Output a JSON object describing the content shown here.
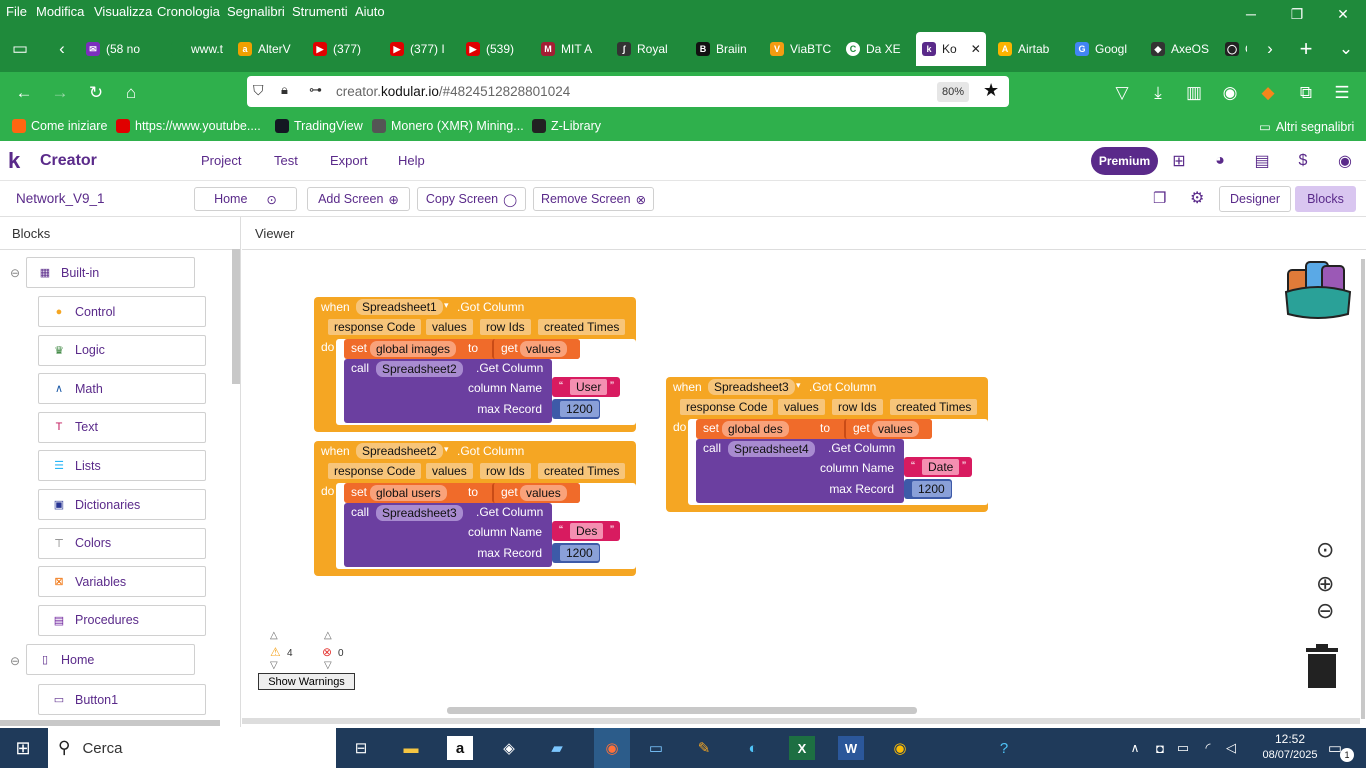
{
  "menubar": {
    "items": [
      "File",
      "Modifica",
      "Visualizza",
      "Cronologia",
      "Segnalibri",
      "Strumenti",
      "Aiuto"
    ]
  },
  "tabs": [
    {
      "label": "(58 no",
      "color": "#7b2fbe",
      "glyph": "✉"
    },
    {
      "label": "www.t",
      "color": "#1f8a3b",
      "glyph": ""
    },
    {
      "label": "AlterV",
      "color": "#f0a000",
      "glyph": "a"
    },
    {
      "label": "(377)",
      "color": "#e00000",
      "glyph": "▶"
    },
    {
      "label": "(377) I",
      "color": "#e00000",
      "glyph": "▶"
    },
    {
      "label": "(539)",
      "color": "#e00000",
      "glyph": "▶"
    },
    {
      "label": "MIT A",
      "color": "#a31f34",
      "glyph": "M"
    },
    {
      "label": "Royal",
      "color": "#333333",
      "glyph": "∫"
    },
    {
      "label": "Braiin",
      "color": "#111111",
      "glyph": "B"
    },
    {
      "label": "ViaBTC",
      "color": "#f39c12",
      "glyph": "V"
    },
    {
      "label": "Da XE",
      "color": "#ffffff",
      "glyph": "C"
    },
    {
      "label": "Ko",
      "color": "#5a2a8a",
      "glyph": "k"
    },
    {
      "label": "Airtab",
      "color": "#fcb400",
      "glyph": "A"
    },
    {
      "label": "Googl",
      "color": "#4285f4",
      "glyph": "G"
    },
    {
      "label": "AxeOS",
      "color": "#333333",
      "glyph": "◆"
    },
    {
      "label": "G",
      "color": "#222222",
      "glyph": "◯"
    }
  ],
  "url": {
    "prefix": "creator.",
    "domain": "kodular.io",
    "path": "/#4824512828801024",
    "zoom": "80%"
  },
  "bookmarks": [
    {
      "label": "Come iniziare",
      "color": "#ff6611"
    },
    {
      "label": "https://www.youtube....",
      "color": "#e00000"
    },
    {
      "label": "TradingView",
      "color": "#131722"
    },
    {
      "label": "Monero (XMR) Mining...",
      "color": "#555555"
    },
    {
      "label": "Z-Library",
      "color": "#222222"
    }
  ],
  "bookmarks_other": "Altri segnalibri",
  "app": {
    "logo": "Creator",
    "menus": [
      "Project",
      "Test",
      "Export",
      "Help"
    ],
    "premium": "Premium"
  },
  "screenbar": {
    "project": "Network_V9_1",
    "home": "Home",
    "add": "Add Screen",
    "copy": "Copy Screen",
    "remove": "Remove Screen",
    "designer": "Designer",
    "blocks": "Blocks"
  },
  "panel": {
    "title": "Blocks",
    "viewer": "Viewer"
  },
  "categories": [
    {
      "label": "Built-in",
      "color": "#5a2a8a",
      "glyph": "▦"
    },
    {
      "label": "Control",
      "color": "#f5a623",
      "glyph": "●"
    },
    {
      "label": "Logic",
      "color": "#2e7d32",
      "glyph": "♛"
    },
    {
      "label": "Math",
      "color": "#1e5ba8",
      "glyph": "∧"
    },
    {
      "label": "Text",
      "color": "#c2185b",
      "glyph": "T"
    },
    {
      "label": "Lists",
      "color": "#29b6f6",
      "glyph": "☰"
    },
    {
      "label": "Dictionaries",
      "color": "#283593",
      "glyph": "▣"
    },
    {
      "label": "Colors",
      "color": "#777777",
      "glyph": "⊤"
    },
    {
      "label": "Variables",
      "color": "#ef6c00",
      "glyph": "⊠"
    },
    {
      "label": "Procedures",
      "color": "#6a1b9a",
      "glyph": "▤"
    },
    {
      "label": "Home",
      "color": "#5a2a8a",
      "glyph": "▯"
    },
    {
      "label": "Button1",
      "color": "#5a2a8a",
      "glyph": "▭"
    }
  ],
  "blocks": [
    {
      "when": "when",
      "comp": "Spreadsheet1",
      "event": ".Got Column",
      "params": [
        "response Code",
        "values",
        "row Ids",
        "created Times"
      ],
      "do": "do",
      "set": "set",
      "var": "global images",
      "to": "to",
      "get": "get",
      "getvar": "values",
      "call": "call",
      "callcomp": "Spreadsheet2",
      "method": ".Get Column",
      "colname": "column Name",
      "colval": "User",
      "maxrec": "max Record",
      "maxval": "1200"
    },
    {
      "when": "when",
      "comp": "Spreadsheet2",
      "event": ".Got Column",
      "params": [
        "response Code",
        "values",
        "row Ids",
        "created Times"
      ],
      "do": "do",
      "set": "set",
      "var": "global users",
      "to": "to",
      "get": "get",
      "getvar": "values",
      "call": "call",
      "callcomp": "Spreadsheet3",
      "method": ".Get Column",
      "colname": "column Name",
      "colval": "Des",
      "maxrec": "max Record",
      "maxval": "1200"
    },
    {
      "when": "when",
      "comp": "Spreadsheet3",
      "event": ".Got Column",
      "params": [
        "response Code",
        "values",
        "row Ids",
        "created Times"
      ],
      "do": "do",
      "set": "set",
      "var": "global des",
      "to": "to",
      "get": "get",
      "getvar": "values",
      "call": "call",
      "callcomp": "Spreadsheet4",
      "method": ".Get Column",
      "colname": "column Name",
      "colval": "Date",
      "maxrec": "max Record",
      "maxval": "1200"
    }
  ],
  "warnings": {
    "count": "4",
    "errors": "0",
    "button": "Show Warnings"
  },
  "taskbar": {
    "search": "Cerca",
    "time": "12:52",
    "date": "08/07/2025",
    "notif": "1"
  },
  "colors": {
    "green_dark": "#1f8a3b",
    "green": "#2fb04c",
    "purple": "#5a2a8a",
    "event": "#f5a623",
    "call": "#6b3fa0",
    "set": "#f06b2a",
    "text": "#d81b60",
    "math": "#3d5aa8"
  }
}
